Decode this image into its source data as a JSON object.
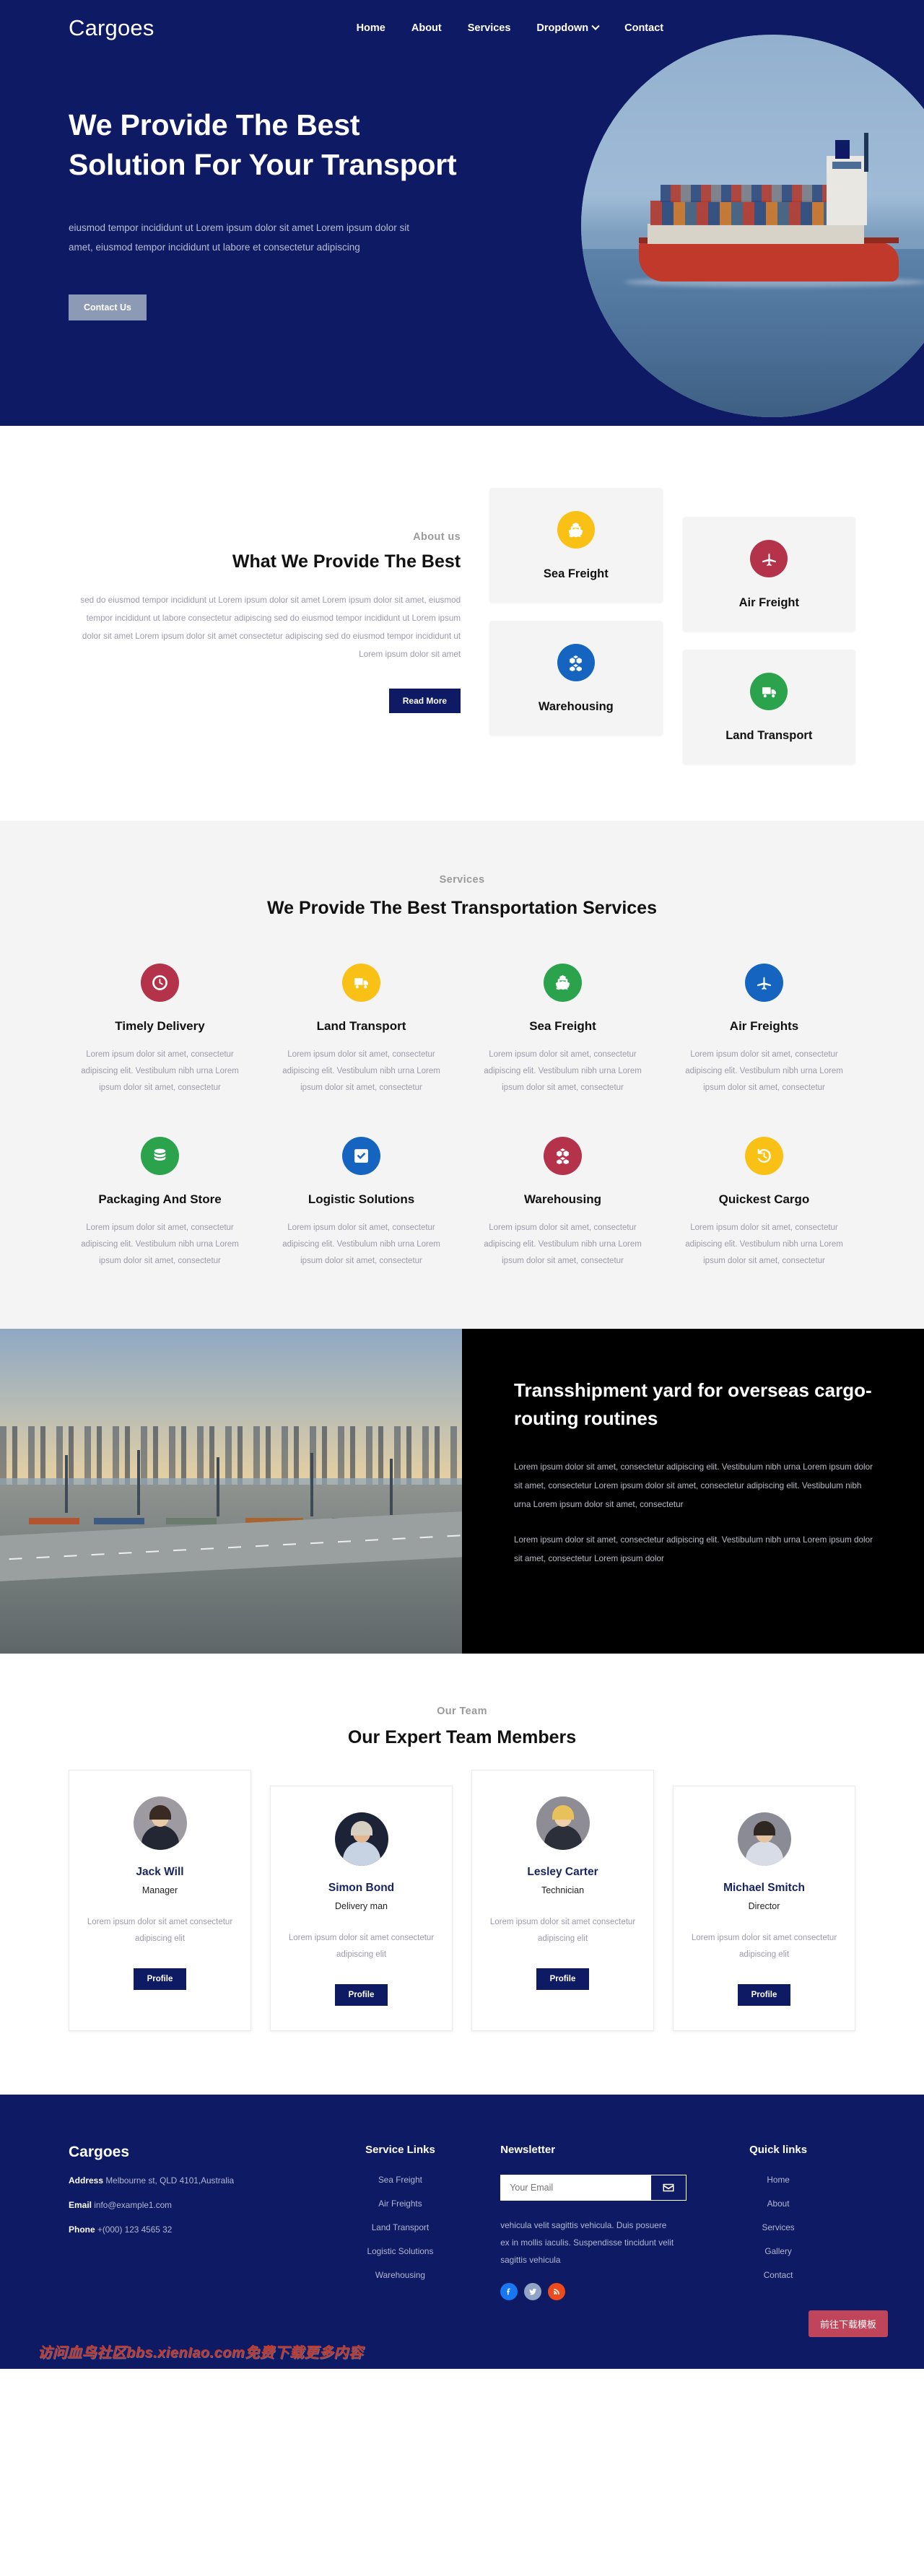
{
  "brand": "Cargoes",
  "nav": {
    "items": [
      {
        "label": "Home"
      },
      {
        "label": "About"
      },
      {
        "label": "Services"
      },
      {
        "label": "Dropdown"
      },
      {
        "label": "Contact"
      }
    ]
  },
  "hero": {
    "title": "We Provide The Best Solution For Your Transport",
    "subtitle": "eiusmod tempor incididunt ut Lorem ipsum dolor sit amet Lorem ipsum dolor sit amet, eiusmod tempor incididunt ut labore et consectetur adipiscing",
    "cta": "Contact Us"
  },
  "about": {
    "eyebrow": "About us",
    "heading": "What We Provide The Best",
    "paragraph": "sed do eiusmod tempor incididunt ut Lorem ipsum dolor sit amet Lorem ipsum dolor sit amet, eiusmod tempor incididunt ut labore consectetur adipiscing sed do eiusmod tempor incididunt ut Lorem ipsum dolor sit amet Lorem ipsum dolor sit amet consectetur adipiscing sed do eiusmod tempor incididunt ut Lorem ipsum dolor sit amet",
    "cta": "Read More",
    "cards": [
      {
        "title": "Sea Freight",
        "icon": "ship-icon",
        "color": "#f9c016"
      },
      {
        "title": "Air Freight",
        "icon": "plane-icon",
        "color": "#b4324a"
      },
      {
        "title": "Warehousing",
        "icon": "boxes-icon",
        "color": "#1565c0"
      },
      {
        "title": "Land Transport",
        "icon": "truck-icon",
        "color": "#2ba24c"
      }
    ]
  },
  "services": {
    "eyebrow": "Services",
    "heading": "We Provide The Best Transportation Services",
    "items": [
      {
        "title": "Timely Delivery",
        "icon": "clock-icon",
        "color": "#b4324a",
        "desc": "Lorem ipsum dolor sit amet, consectetur adipiscing elit. Vestibulum nibh urna Lorem ipsum dolor sit amet, consectetur"
      },
      {
        "title": "Land Transport",
        "icon": "truck-icon",
        "color": "#f9c016",
        "desc": "Lorem ipsum dolor sit amet, consectetur adipiscing elit. Vestibulum nibh urna Lorem ipsum dolor sit amet, consectetur"
      },
      {
        "title": "Sea Freight",
        "icon": "ship-icon",
        "color": "#2ba24c",
        "desc": "Lorem ipsum dolor sit amet, consectetur adipiscing elit. Vestibulum nibh urna Lorem ipsum dolor sit amet, consectetur"
      },
      {
        "title": "Air Freights",
        "icon": "plane-icon",
        "color": "#1565c0",
        "desc": "Lorem ipsum dolor sit amet, consectetur adipiscing elit. Vestibulum nibh urna Lorem ipsum dolor sit amet, consectetur"
      },
      {
        "title": "Packaging And Store",
        "icon": "database-icon",
        "color": "#2ba24c",
        "desc": "Lorem ipsum dolor sit amet, consectetur adipiscing elit. Vestibulum nibh urna Lorem ipsum dolor sit amet, consectetur"
      },
      {
        "title": "Logistic Solutions",
        "icon": "check-square-icon",
        "color": "#1565c0",
        "desc": "Lorem ipsum dolor sit amet, consectetur adipiscing elit. Vestibulum nibh urna Lorem ipsum dolor sit amet, consectetur"
      },
      {
        "title": "Warehousing",
        "icon": "boxes-icon",
        "color": "#b4324a",
        "desc": "Lorem ipsum dolor sit amet, consectetur adipiscing elit. Vestibulum nibh urna Lorem ipsum dolor sit amet, consectetur"
      },
      {
        "title": "Quickest Cargo",
        "icon": "history-icon",
        "color": "#f9c016",
        "desc": "Lorem ipsum dolor sit amet, consectetur adipiscing elit. Vestibulum nibh urna Lorem ipsum dolor sit amet, consectetur"
      }
    ]
  },
  "transshipment": {
    "heading": "Transshipment yard for overseas cargo-routing routines",
    "paragraph1": "Lorem ipsum dolor sit amet, consectetur adipiscing elit. Vestibulum nibh urna Lorem ipsum dolor sit amet, consectetur Lorem ipsum dolor sit amet, consectetur adipiscing elit. Vestibulum nibh urna Lorem ipsum dolor sit amet, consectetur",
    "paragraph2": "Lorem ipsum dolor sit amet, consectetur adipiscing elit. Vestibulum nibh urna Lorem ipsum dolor sit amet, consectetur Lorem ipsum dolor"
  },
  "team": {
    "eyebrow": "Our Team",
    "heading": "Our Expert Team Members",
    "members": [
      {
        "name": "Jack Will",
        "role": "Manager",
        "bio": "Lorem ipsum dolor sit amet consectetur adipiscing elit",
        "cta": "Profile",
        "skin": "#e8c9a8",
        "hair": "#3a2a24",
        "shirt": "#232733",
        "bg": "#9d9aa2"
      },
      {
        "name": "Simon Bond",
        "role": "Delivery man",
        "bio": "Lorem ipsum dolor sit amet consectetur adipiscing elit",
        "cta": "Profile",
        "skin": "#e4b892",
        "hair": "#d7cfc2",
        "shirt": "#c7d3e2",
        "bg": "#1d2336"
      },
      {
        "name": "Lesley Carter",
        "role": "Technician",
        "bio": "Lorem ipsum dolor sit amet consectetur adipiscing elit",
        "cta": "Profile",
        "skin": "#efcfa8",
        "hair": "#e8c15a",
        "shirt": "#2b2f3a",
        "bg": "#8e8d96"
      },
      {
        "name": "Michael Smitch",
        "role": "Director",
        "bio": "Lorem ipsum dolor sit amet consectetur adipiscing elit",
        "cta": "Profile",
        "skin": "#e6c3a0",
        "hair": "#2f2722",
        "shirt": "#d7dce6",
        "bg": "#8b8b95"
      }
    ]
  },
  "footer": {
    "brand": "Cargoes",
    "address_label": "Address",
    "address_value": "Melbourne st, QLD 4101,Australia",
    "email_label": "Email",
    "email_value": "info@example1.com",
    "phone_label": "Phone",
    "phone_value": "+(000) 123 4565 32",
    "service_links_title": "Service Links",
    "service_links": [
      {
        "label": "Sea Freight"
      },
      {
        "label": "Air Freights"
      },
      {
        "label": "Land Transport"
      },
      {
        "label": "Logistic Solutions"
      },
      {
        "label": "Warehousing"
      }
    ],
    "newsletter_title": "Newsletter",
    "newsletter_placeholder": "Your Email",
    "newsletter_value": "",
    "newsletter_text": "vehicula velit sagittis vehicula. Duis posuere ex in mollis iaculis. Suspendisse tincidunt velit sagittis vehicula",
    "socials": [
      {
        "name": "facebook-icon",
        "color": "#1877f2"
      },
      {
        "name": "twitter-icon",
        "color": "#8fa4c6"
      },
      {
        "name": "rss-icon",
        "color": "#ef4a1b"
      }
    ],
    "quick_links_title": "Quick links",
    "quick_links": [
      {
        "label": "Home"
      },
      {
        "label": "About"
      },
      {
        "label": "Services"
      },
      {
        "label": "Gallery"
      },
      {
        "label": "Contact"
      }
    ],
    "download_button": "前往下载模板",
    "watermark": "访问血鸟社区bbs.xienIao.com免费下载更多内容"
  },
  "colors": {
    "primary": "#0e1a63",
    "yellow": "#f9c016",
    "red": "#b4324a",
    "blue": "#1565c0",
    "green": "#2ba24c",
    "accent_pink": "#c0445a"
  }
}
